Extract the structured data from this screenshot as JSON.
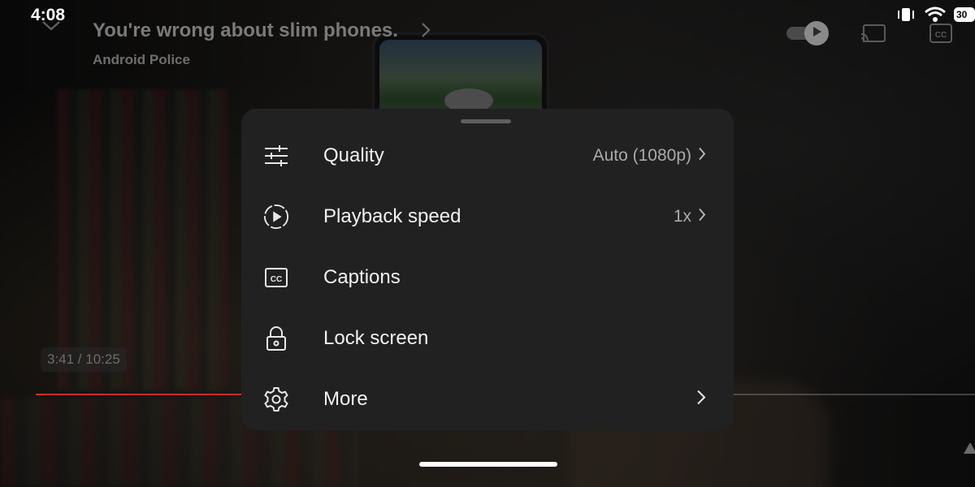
{
  "status_bar": {
    "time": "4:08",
    "battery": "30"
  },
  "player": {
    "title": "You're wrong about slim phones.",
    "channel": "Android Police",
    "timecode": "3:41 / 10:25",
    "progress_fraction": 0.359
  },
  "settings_menu": {
    "items": [
      {
        "label": "Quality",
        "value": "Auto (1080p)",
        "icon": "sliders-icon"
      },
      {
        "label": "Playback speed",
        "value": "1x",
        "icon": "playback-speed-icon"
      },
      {
        "label": "Captions",
        "value": "",
        "icon": "captions-icon"
      },
      {
        "label": "Lock screen",
        "value": "",
        "icon": "lock-icon"
      },
      {
        "label": "More",
        "value": "",
        "icon": "gear-icon"
      }
    ]
  },
  "colors": {
    "progress": "#c4302b",
    "sheet_bg": "#212121"
  }
}
